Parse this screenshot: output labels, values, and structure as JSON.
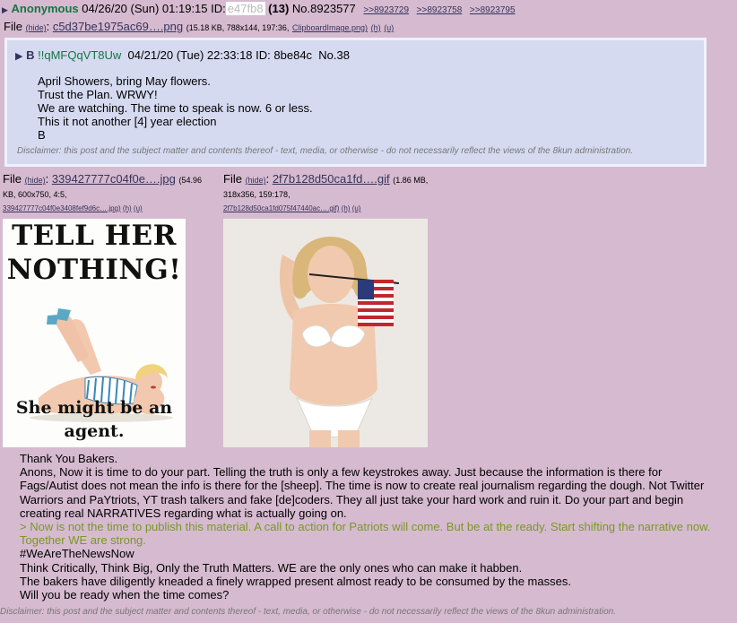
{
  "post": {
    "name": "Anonymous",
    "date": "04/26/20 (Sun) 01:19:15",
    "id_label": "ID:",
    "id_value": "e47fb8",
    "count": "(13)",
    "post_no": "No.8923577",
    "backlinks": [
      ">>8923729",
      ">>8923758",
      ">>8923795"
    ],
    "file": {
      "label": "File",
      "hide": "(hide)",
      "name": "c5d37be1975ac69….png",
      "meta": "(15.18 KB, 788x144, 197:36,",
      "orig": "ClipboardImage.png)",
      "h": "(h)",
      "u": "(u)"
    }
  },
  "quoted": {
    "b": "B",
    "trip": "!!qMFQqVT8Uw",
    "date": "04/21/20 (Tue) 22:33:18",
    "id": "ID: 8be84c",
    "no": "No.38",
    "lines": [
      "April Showers, bring May flowers.",
      "Trust the Plan. WRWY!",
      "We are watching. The time to speak is now. 6 or less.",
      "This it not another [4] year election",
      "B"
    ],
    "disclaimer": "Disclaimer: this post and the subject matter and contents thereof - text, media, or otherwise - do not necessarily reflect the views of the 8kun administration."
  },
  "files": [
    {
      "label": "File",
      "hide": "(hide)",
      "name": "339427777c04f0e….jpg",
      "meta1": "(54.96",
      "meta2": "KB, 600x750, 4:5,",
      "orig": "339427777c04f0e3408fef9d6c….jpg)",
      "h": "(h)",
      "u": "(u)"
    },
    {
      "label": "File",
      "hide": "(hide)",
      "name": "2f7b128d50ca1fd….gif",
      "meta1": "(1.86 MB,",
      "meta2": "318x356, 159:178,",
      "orig": "2f7b128d50ca1fd075f47440ac….gif)",
      "h": "(h)",
      "u": "(u)"
    }
  ],
  "image1": {
    "top1": "TELL HER",
    "top2": "NOTHING!",
    "bottom1": "She might be an",
    "bottom2": "agent."
  },
  "body": {
    "l1": "Thank You Bakers.",
    "l2": "Anons, Now it is time to do your part. Telling the truth is only a few keystrokes away. Just because the information is there for Fags/Autist does not mean the info is there for the [sheep]. The time is now to create real journalism regarding the dough. Not Twitter Warriors and PaYtriots, YT trash talkers and fake [de]coders. They all just take your hard work and ruin it. Do your part and begin creating real NARRATIVES regarding what is actually going on.",
    "green": "> Now is not the time to publish this material. A call to action for Patriots will come. But be at the ready. Start shifting the narrative now. Together WE are strong.",
    "l4": "#WeAreTheNewsNow",
    "l5": "Think Critically, Think Big, Only the Truth Matters. WE are the only ones who can make it habben.",
    "l6": "The bakers have diligently kneaded a finely wrapped present almost ready to be consumed by the masses.",
    "l7": "Will you be ready when the time comes?"
  },
  "disclaimer": "Disclaimer: this post and the subject matter and contents thereof - text, media, or otherwise - do not necessarily reflect the views of the 8kun administration."
}
